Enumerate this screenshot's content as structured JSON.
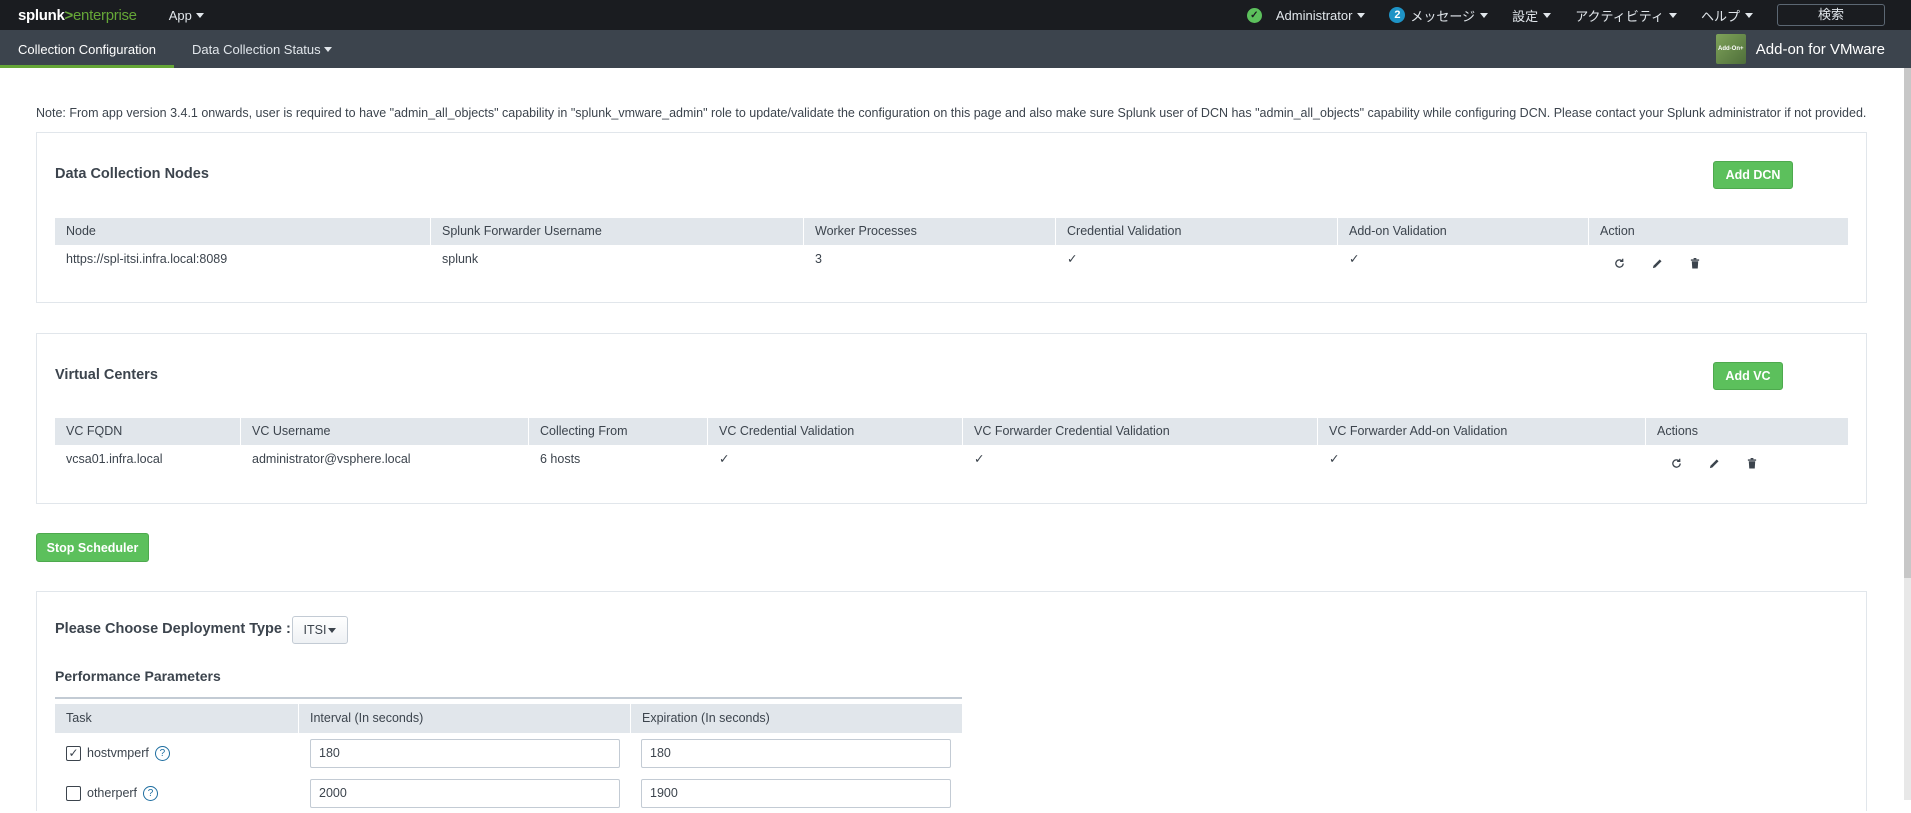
{
  "topbar": {
    "logo_splunk": "splunk",
    "logo_gt": ">",
    "logo_enterprise": "enterprise",
    "app_menu": "App",
    "user": "Administrator",
    "messages_count": "2",
    "messages": "メッセージ",
    "settings": "設定",
    "activity": "アクティビティ",
    "help": "ヘルプ",
    "search": "検索"
  },
  "appnav": {
    "tabs": [
      {
        "label": "Collection Configuration",
        "active": true
      },
      {
        "label": "Data Collection Status",
        "active": false
      }
    ],
    "app_icon_text": "Add-On+",
    "app_title": "Add-on for VMware"
  },
  "note": "Note: From app version 3.4.1 onwards, user is required to have \"admin_all_objects\" capability in \"splunk_vmware_admin\" role to update/validate the configuration on this page and also make sure Splunk user of DCN has \"admin_all_objects\" capability while configuring DCN. Please contact your Splunk administrator if not provided.",
  "dcn": {
    "title": "Data Collection Nodes",
    "add_button": "Add DCN",
    "columns": [
      "Node",
      "Splunk Forwarder Username",
      "Worker Processes",
      "Credential Validation",
      "Add-on Validation",
      "Action"
    ],
    "rows": [
      {
        "node": "https://spl-itsi.infra.local:8089",
        "username": "splunk",
        "workers": "3",
        "cred_valid": "✓",
        "addon_valid": "✓"
      }
    ]
  },
  "vc": {
    "title": "Virtual Centers",
    "add_button": "Add VC",
    "columns": [
      "VC FQDN",
      "VC Username",
      "Collecting From",
      "VC Credential Validation",
      "VC Forwarder Credential Validation",
      "VC Forwarder Add-on Validation",
      "Actions"
    ],
    "rows": [
      {
        "fqdn": "vcsa01.infra.local",
        "username": "administrator@vsphere.local",
        "collecting": "6 hosts",
        "vc_cred": "✓",
        "fwd_cred": "✓",
        "fwd_addon": "✓"
      }
    ]
  },
  "scheduler_button": "Stop Scheduler",
  "deployment": {
    "label": "Please Choose Deployment Type :",
    "selected": "ITSI"
  },
  "performance": {
    "title": "Performance Parameters",
    "columns": [
      "Task",
      "Interval (In seconds)",
      "Expiration (In seconds)"
    ],
    "rows": [
      {
        "task": "hostvmperf",
        "checked": true,
        "interval": "180",
        "expiration": "180"
      },
      {
        "task": "otherperf",
        "checked": false,
        "interval": "2000",
        "expiration": "1900"
      }
    ]
  },
  "colors": {
    "topbar_bg": "#1a1c20",
    "nav_bg": "#3c444d",
    "accent_green": "#5cc05c",
    "link": "#1e6ea0"
  }
}
